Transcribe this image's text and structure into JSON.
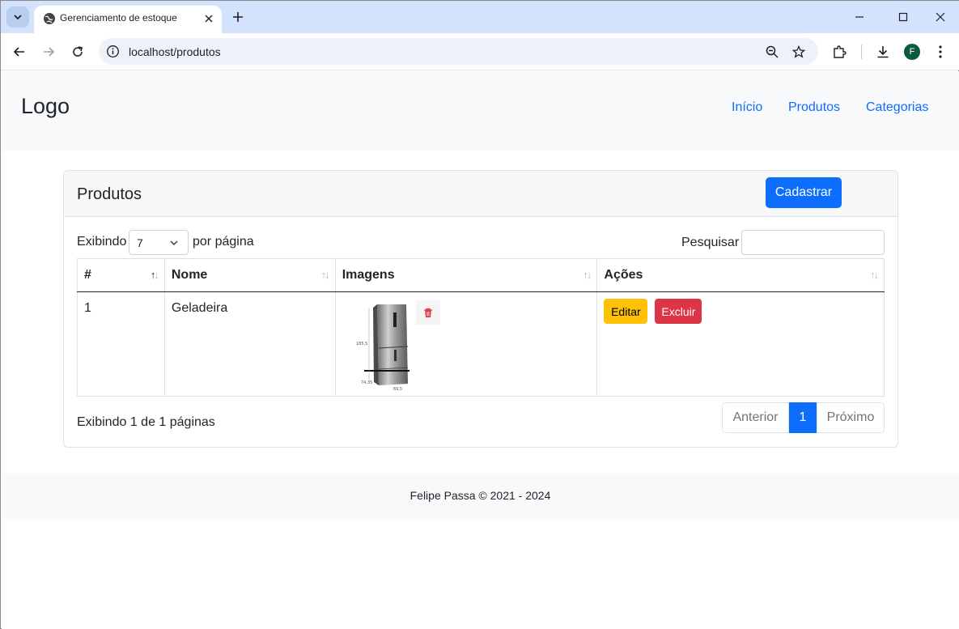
{
  "browser": {
    "tab_title": "Gerenciamento de estoque",
    "url": "localhost/produtos",
    "profile_initial": "F"
  },
  "header": {
    "logo": "Logo",
    "nav": [
      {
        "label": "Início"
      },
      {
        "label": "Produtos"
      },
      {
        "label": "Categorias"
      }
    ]
  },
  "card": {
    "title": "Produtos",
    "add_button": "Cadastrar",
    "length_prefix": "Exibindo",
    "length_value": "7",
    "length_suffix": "por página",
    "search_label": "Pesquisar",
    "search_value": "",
    "columns": [
      "#",
      "Nome",
      "Imagens",
      "Ações"
    ],
    "rows": [
      {
        "id": "1",
        "name": "Geladeira",
        "edit": "Editar",
        "delete": "Excluir"
      }
    ],
    "info": "Exibindo 1 de 1 páginas",
    "pagination": {
      "prev": "Anterior",
      "current": "1",
      "next": "Próximo"
    }
  },
  "footer": {
    "text": "Felipe Passa © 2021 - 2024"
  },
  "colors": {
    "primary": "#0d6efd",
    "warning": "#ffc107",
    "danger": "#dc3545",
    "header_bg": "#f8f9fa"
  }
}
